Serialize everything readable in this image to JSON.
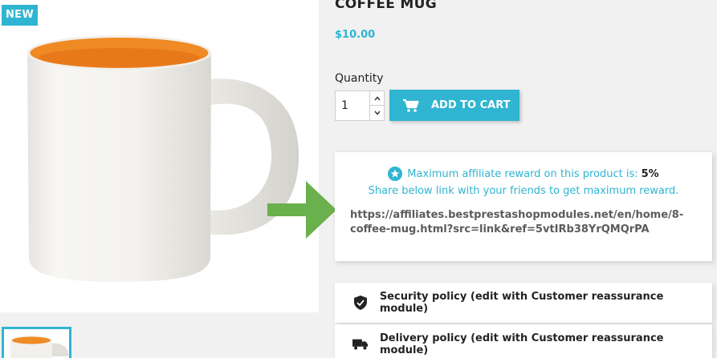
{
  "product": {
    "badge": "NEW",
    "title": "COFFEE MUG",
    "price": "$10.00",
    "quantity_label": "Quantity",
    "quantity_value": "1",
    "add_to_cart_label": "ADD TO CART"
  },
  "affiliate": {
    "reward_text": "Maximum affiliate reward on this product is:",
    "reward_percent": "5%",
    "share_text": "Share below link with your friends to get maximum reward.",
    "link": "https://affiliates.bestprestashopmodules.net/en/home/8-coffee-mug.html?src=link&ref=5vtIRb38YrQMQrPA"
  },
  "reassurance": [
    {
      "icon": "shield-icon",
      "label": "Security policy (edit with Customer reassurance module)"
    },
    {
      "icon": "truck-icon",
      "label": "Delivery policy (edit with Customer reassurance module)"
    }
  ],
  "colors": {
    "accent": "#2fb5d2",
    "arrow": "#6ab04c",
    "mug_inner": "#f08a24"
  }
}
